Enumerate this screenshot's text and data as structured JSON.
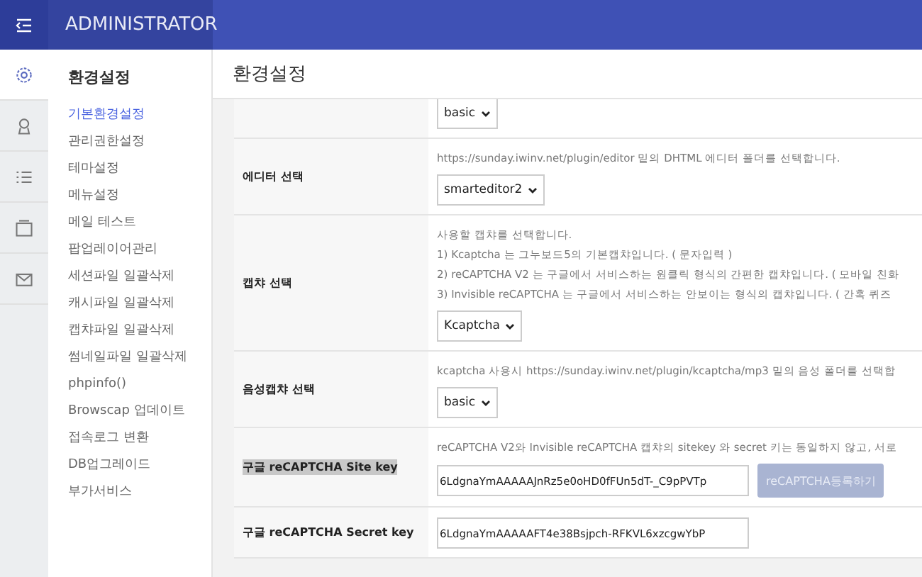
{
  "header": {
    "title": "ADMINISTRATOR"
  },
  "rail": [
    {
      "kind": "gear",
      "selected": true
    },
    {
      "kind": "person",
      "selected": false
    },
    {
      "kind": "list",
      "selected": false
    },
    {
      "kind": "box",
      "selected": false
    },
    {
      "kind": "mail",
      "selected": false
    }
  ],
  "submenu": {
    "title": "환경설정",
    "items": [
      {
        "label": "기본환경설정",
        "selected": true
      },
      {
        "label": "관리권한설정",
        "selected": false
      },
      {
        "label": "테마설정",
        "selected": false
      },
      {
        "label": "메뉴설정",
        "selected": false
      },
      {
        "label": "메일 테스트",
        "selected": false
      },
      {
        "label": "팝업레이어관리",
        "selected": false
      },
      {
        "label": "세션파일 일괄삭제",
        "selected": false
      },
      {
        "label": "캐시파일 일괄삭제",
        "selected": false
      },
      {
        "label": "캡챠파일 일괄삭제",
        "selected": false
      },
      {
        "label": "썸네일파일 일괄삭제",
        "selected": false
      },
      {
        "label": "phpinfo()",
        "selected": false
      },
      {
        "label": "Browscap 업데이트",
        "selected": false
      },
      {
        "label": "접속로그 변환",
        "selected": false
      },
      {
        "label": "DB업그레이드",
        "selected": false
      },
      {
        "label": "부가서비스",
        "selected": false
      }
    ]
  },
  "page": {
    "title": "환경설정"
  },
  "rows": [
    {
      "kind": "select",
      "help": [],
      "value": "basic"
    },
    {
      "kind": "select",
      "label": "에디터 선택",
      "highlighted": false,
      "help": [
        "https://sunday.iwinv.net/plugin/editor 밑의 DHTML 에디터 폴더를 선택합니다."
      ],
      "value": "smarteditor2"
    },
    {
      "kind": "select",
      "label": "캡챠 선택",
      "highlighted": false,
      "help": [
        "사용할 캡챠를 선택합니다.",
        "1) Kcaptcha 는 그누보드5의 기본캡챠입니다. ( 문자입력 )",
        "2) reCAPTCHA V2 는 구글에서 서비스하는 원클릭 형식의 간편한 캡챠입니다. ( 모바일 친화",
        "3) Invisible reCAPTCHA 는 구글에서 서비스하는 안보이는 형식의 캡챠입니다. ( 간혹 퀴즈"
      ],
      "value": "Kcaptcha"
    },
    {
      "kind": "select",
      "label": "음성캡챠 선택",
      "highlighted": false,
      "help": [
        "kcaptcha 사용시 https://sunday.iwinv.net/plugin/kcaptcha/mp3 밑의 음성 폴더를 선택합"
      ],
      "value": "basic"
    },
    {
      "kind": "input",
      "label": "구글 reCAPTCHA Site key",
      "highlighted": true,
      "help": [
        "reCAPTCHA V2와 Invisible reCAPTCHA 캡챠의 sitekey 와 secret 키는 동일하지 않고, 서로"
      ],
      "value": "6LdgnaYmAAAAAJnRz5e0oHD0fFUn5dT-_C9pPVTp",
      "button": {
        "label": "reCAPTCHA등록하기",
        "disabled": true
      }
    },
    {
      "kind": "input",
      "label": "구글 reCAPTCHA Secret key",
      "highlighted": false,
      "help": [],
      "value": "6LdgnaYmAAAAAFT4e38Bsjpch-RFKVL6xzcgwYbP"
    }
  ]
}
